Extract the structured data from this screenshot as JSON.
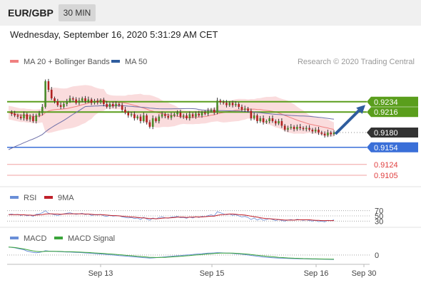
{
  "header": {
    "symbol": "EUR/GBP",
    "timeframe": "30 MIN"
  },
  "datetime": "Wednesday, September 16, 2020 5:31:29 AM CET",
  "credit": "Research © 2020 Trading Central",
  "chart_data": [
    {
      "type": "line",
      "name": "price",
      "legend": [
        {
          "label": "MA 20 + Bollinger Bands",
          "color": "#f08080"
        },
        {
          "label": "MA 50",
          "color": "#2f5d9e"
        }
      ],
      "ylim": [
        0.9095,
        0.929
      ],
      "close_series": [
        0.9215,
        0.9213,
        0.921,
        0.9208,
        0.9205,
        0.9212,
        0.9203,
        0.9208,
        0.92,
        0.921,
        0.9214,
        0.9225,
        0.927,
        0.9255,
        0.924,
        0.9235,
        0.9228,
        0.9225,
        0.923,
        0.9235,
        0.924,
        0.9238,
        0.9232,
        0.9236,
        0.924,
        0.9235,
        0.9238,
        0.9232,
        0.9235,
        0.9233,
        0.9237,
        0.923,
        0.9225,
        0.923,
        0.9226,
        0.923,
        0.9228,
        0.922,
        0.9215,
        0.921,
        0.9212,
        0.9205,
        0.9208,
        0.92,
        0.921,
        0.9198,
        0.919,
        0.9205,
        0.92,
        0.9208,
        0.9212,
        0.9209,
        0.9206,
        0.921,
        0.9212,
        0.9215,
        0.9208,
        0.921,
        0.9205,
        0.9212,
        0.9208,
        0.9213,
        0.921,
        0.9215,
        0.9213,
        0.9218,
        0.922,
        0.9215,
        0.9236,
        0.9233,
        0.9232,
        0.9228,
        0.9232,
        0.9228,
        0.923,
        0.9225,
        0.922,
        0.9222,
        0.9218,
        0.9205,
        0.921,
        0.92,
        0.9205,
        0.9198,
        0.92,
        0.9205,
        0.92,
        0.9196,
        0.92,
        0.9192,
        0.9185,
        0.9188,
        0.919,
        0.9186,
        0.919,
        0.9188,
        0.9186,
        0.9188,
        0.9185,
        0.9182,
        0.9185,
        0.918,
        0.9178,
        0.9175,
        0.918,
        0.9177,
        0.918
      ],
      "ma50_start": 0.915,
      "ma50_end": 0.919,
      "levels": [
        {
          "value": "0.9234",
          "kind": "resistance",
          "color": "#5a9e1c"
        },
        {
          "value": "0.9216",
          "kind": "resistance",
          "color": "#5a9e1c"
        },
        {
          "value": "0.9180",
          "kind": "current",
          "color": "#333333"
        },
        {
          "value": "0.9154",
          "kind": "pivot",
          "color": "#3a6fd8"
        },
        {
          "value": "0.9124",
          "kind": "support",
          "color": "#e04040"
        },
        {
          "value": "0.9105",
          "kind": "support",
          "color": "#e04040"
        }
      ],
      "arrow": {
        "from": 0.918,
        "to": 0.9216,
        "color": "#2f5d9e"
      }
    },
    {
      "type": "line",
      "name": "rsi",
      "legend": [
        {
          "label": "RSI",
          "color": "#6a8fd8"
        },
        {
          "label": "9MA",
          "color": "#c0202a"
        }
      ],
      "ylim": [
        20,
        80
      ],
      "levels": [
        "70",
        "50",
        "30"
      ],
      "rsi_series": [
        55,
        57,
        54,
        56,
        52,
        55,
        50,
        53,
        48,
        56,
        58,
        62,
        70,
        60,
        57,
        54,
        52,
        55,
        58,
        60,
        62,
        59,
        56,
        58,
        60,
        55,
        57,
        52,
        54,
        53,
        56,
        50,
        48,
        52,
        49,
        50,
        51,
        46,
        44,
        42,
        44,
        40,
        42,
        36,
        45,
        38,
        33,
        42,
        38,
        44,
        46,
        43,
        41,
        45,
        46,
        48,
        43,
        44,
        41,
        46,
        42,
        47,
        44,
        48,
        47,
        51,
        54,
        50,
        66,
        62,
        58,
        54,
        57,
        52,
        55,
        50,
        46,
        48,
        44,
        36,
        42,
        34,
        40,
        33,
        36,
        40,
        36,
        32,
        36,
        32,
        30,
        34,
        36,
        33,
        37,
        35,
        33,
        35,
        32,
        30,
        33,
        28,
        30,
        27,
        33,
        31,
        35
      ],
      "ma_series": [
        55,
        55,
        55,
        55,
        54,
        54,
        53,
        53,
        52,
        53,
        54,
        55,
        57,
        58,
        58,
        57,
        57,
        56,
        57,
        58,
        58,
        58,
        58,
        58,
        58,
        57,
        57,
        56,
        55,
        55,
        55,
        54,
        53,
        52,
        51,
        51,
        50,
        49,
        48,
        47,
        46,
        45,
        44,
        43,
        42,
        41,
        40,
        40,
        39,
        40,
        41,
        42,
        42,
        43,
        44,
        45,
        45,
        45,
        44,
        45,
        45,
        46,
        46,
        46,
        47,
        48,
        49,
        49,
        52,
        54,
        55,
        56,
        57,
        57,
        56,
        55,
        54,
        53,
        51,
        49,
        47,
        45,
        43,
        41,
        40,
        39,
        38,
        37,
        36,
        35,
        34,
        34,
        34,
        34,
        35,
        35,
        35,
        35,
        35,
        34,
        33,
        33,
        32,
        32,
        32,
        32,
        32
      ]
    },
    {
      "type": "line",
      "name": "macd",
      "legend": [
        {
          "label": "MACD",
          "color": "#6a8fd8"
        },
        {
          "label": "MACD Signal",
          "color": "#3aa53a"
        }
      ],
      "ylim": [
        -12,
        14
      ],
      "levels": [
        "0"
      ],
      "macd_series": [
        12,
        11.5,
        11,
        10,
        9,
        8,
        6,
        5,
        4,
        3.5,
        4,
        5,
        6.5,
        6,
        5.8,
        5.5,
        5.2,
        5,
        4.8,
        4.6,
        4.5,
        4.3,
        4,
        3.8,
        3.6,
        3.2,
        3,
        2.6,
        2.2,
        1.8,
        1.5,
        1.2,
        0.8,
        0.4,
        0,
        -0.4,
        -0.8,
        -1.2,
        -1.6,
        -2,
        -2.4,
        -2.8,
        -3.2,
        -3.6,
        -4,
        -4.3,
        -4.6,
        -4.4,
        -4,
        -3.6,
        -3.2,
        -2.8,
        -2.4,
        -2,
        -1.6,
        -1.2,
        -0.8,
        -0.4,
        0,
        0.4,
        0.8,
        1.2,
        1.6,
        2,
        2.4,
        2.8,
        3,
        3.2,
        3.6,
        3.4,
        3.2,
        3,
        2.8,
        2.4,
        2,
        1.6,
        1.2,
        0.6,
        0,
        -0.6,
        -1.2,
        -1.8,
        -2.4,
        -3,
        -3.4,
        -3.8,
        -4.2,
        -4.4,
        -4.6,
        -4.8,
        -5,
        -5.2,
        -5.4,
        -5.5,
        -5.6,
        -5.7,
        -5.8,
        -5.9,
        -6,
        -6.1,
        -6.2,
        -6.3,
        -6.4,
        -6.5,
        -6.6,
        -6.7,
        -6.8
      ],
      "signal_series": [
        12,
        11.8,
        11.4,
        10.8,
        10,
        9.2,
        8.2,
        7.2,
        6.3,
        5.6,
        5.2,
        5.2,
        5.5,
        5.6,
        5.6,
        5.6,
        5.5,
        5.4,
        5.2,
        5.1,
        5,
        4.9,
        4.7,
        4.5,
        4.3,
        4,
        3.8,
        3.5,
        3.2,
        2.9,
        2.6,
        2.3,
        2,
        1.6,
        1.3,
        0.9,
        0.5,
        0.1,
        -0.3,
        -0.7,
        -1.1,
        -1.5,
        -1.9,
        -2.3,
        -2.7,
        -3.1,
        -3.5,
        -3.7,
        -3.8,
        -3.8,
        -3.7,
        -3.5,
        -3.2,
        -2.9,
        -2.6,
        -2.3,
        -2,
        -1.6,
        -1.2,
        -0.8,
        -0.4,
        0,
        0.4,
        0.8,
        1.2,
        1.6,
        2,
        2.3,
        2.6,
        2.8,
        3,
        3,
        3,
        2.8,
        2.6,
        2.3,
        2,
        1.6,
        1.2,
        0.7,
        0.2,
        -0.3,
        -0.8,
        -1.3,
        -1.8,
        -2.3,
        -2.7,
        -3.1,
        -3.5,
        -3.8,
        -4.1,
        -4.4,
        -4.6,
        -4.8,
        -5,
        -5.2,
        -5.4,
        -5.5,
        -5.6,
        -5.7,
        -5.8,
        -5.9,
        -6,
        -6.1,
        -6.2,
        -6.3,
        -6.4
      ]
    }
  ],
  "xaxis": {
    "ticks": [
      "Sep 13",
      "Sep 15",
      "Sep 16",
      "Sep 30"
    ]
  }
}
